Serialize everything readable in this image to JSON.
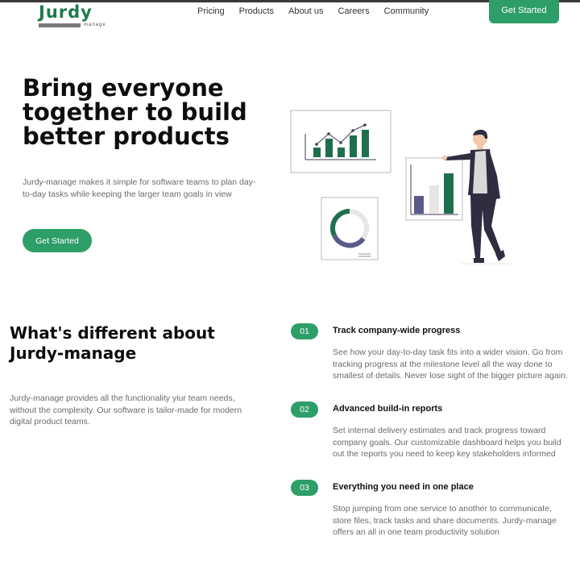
{
  "brand": {
    "name": "Jurdy",
    "sub": "manage",
    "primary_color": "#2e9e68",
    "logo_color": "#1f7a4a"
  },
  "nav": {
    "items": [
      "Pricing",
      "Products",
      "About us",
      "Careers",
      "Community"
    ],
    "cta": "Get Started"
  },
  "hero": {
    "title": "Bring everyone together to build better products",
    "description": "Jurdy-manage makes it simple for software teams to plan day-to-day tasks while keeping the larger team goals in view",
    "cta": "Get Started"
  },
  "difference": {
    "title": "What's different about Jurdy-manage",
    "description": "Jurdy-manage provides all the functionality yiur team needs, without the complexity. Our software is tailor-made for modern digital product teams.",
    "features": [
      {
        "number": "01",
        "title": "Track company-wide progress",
        "description": "See how your day-to-day task fits into a wider vision. Go from tracking progress at the milestone level all the way done to smallest of details. Never lose sight of the bigger picture again."
      },
      {
        "number": "02",
        "title": "Advanced build-in reports",
        "description": "Set internal delivery estimates and track progress toward company goals. Our customizable dashboard helps you build out the reports you need to keep key stakeholders informed"
      },
      {
        "number": "03",
        "title": "Everything you need in one place",
        "description": "Stop jumping from one service to another to communicate, store files, track tasks and share documents. Jurdy-manage offers an all in one team productivity solution"
      }
    ]
  }
}
